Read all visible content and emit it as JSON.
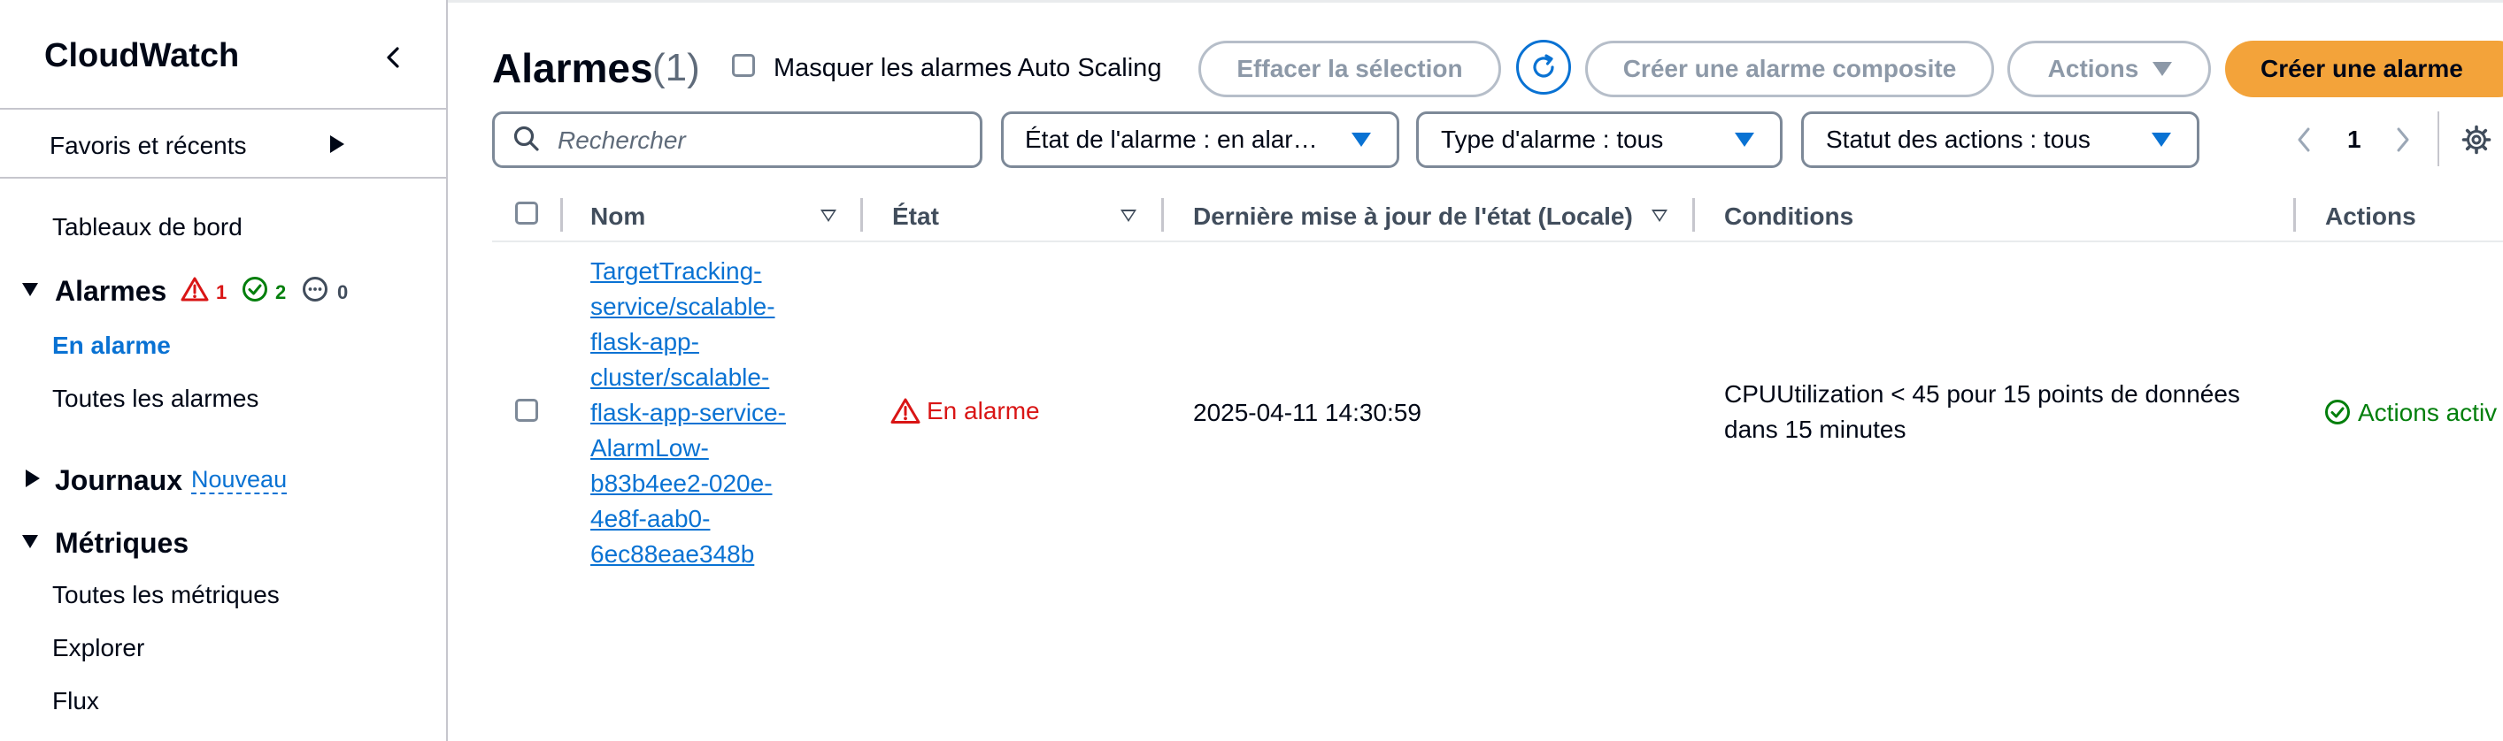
{
  "sidebar": {
    "title": "CloudWatch",
    "favorites": "Favoris et récents",
    "dashboards": "Tableaux de bord",
    "alarms": {
      "label": "Alarmes",
      "in_alarm_count": "1",
      "ok_count": "2",
      "insufficient_count": "0",
      "items": [
        "En alarme",
        "Toutes les alarmes"
      ]
    },
    "logs": {
      "label": "Journaux",
      "badge": "Nouveau"
    },
    "metrics": {
      "label": "Métriques",
      "items": [
        "Toutes les métriques",
        "Explorer",
        "Flux"
      ]
    }
  },
  "header": {
    "title": "Alarmes",
    "count": "(1)",
    "hide_autoscaling": "Masquer les alarmes Auto Scaling",
    "clear_selection": "Effacer la sélection",
    "create_composite": "Créer une alarme composite",
    "actions": "Actions",
    "create_alarm": "Créer une alarme"
  },
  "filters": {
    "search_placeholder": "Rechercher",
    "state": "État de l'alarme : en alar…",
    "type": "Type d'alarme : tous",
    "actions_status": "Statut des actions : tous",
    "page": "1"
  },
  "table": {
    "headers": {
      "name": "Nom",
      "state": "État",
      "last_update": "Dernière mise à jour de l'état (Locale)",
      "conditions": "Conditions",
      "actions": "Actions"
    },
    "rows": [
      {
        "name": "TargetTracking-service/scalable-flask-app-cluster/scalable-flask-app-service-AlarmLow-b83b4ee2-020e-4e8f-aab0-6ec88eae348b",
        "state": "En alarme",
        "last_update": "2025-04-11 14:30:59",
        "conditions": "CPUUtilization < 45 pour 15 points de données dans 15 minutes",
        "actions": "Actions activ"
      }
    ]
  },
  "colors": {
    "link": "#0972d3",
    "alarm_red": "#d91515",
    "ok_green": "#037f0c",
    "primary_orange": "#f3a33a",
    "text": "#000716"
  }
}
